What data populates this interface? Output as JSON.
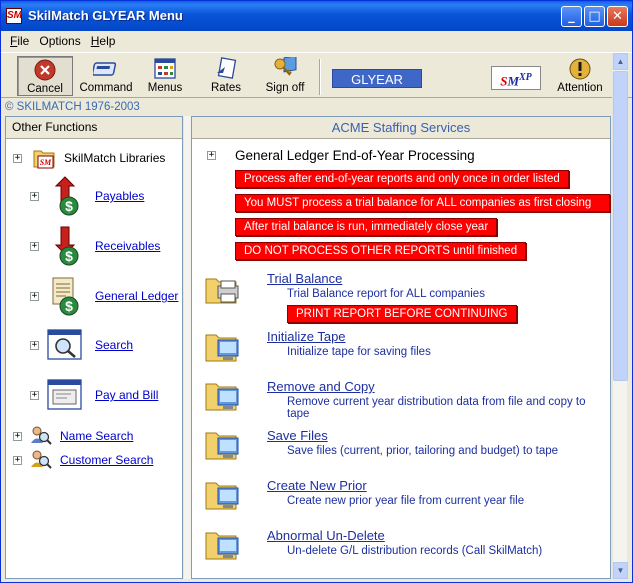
{
  "window": {
    "title": "SkilMatch GLYEAR Menu",
    "app_icon_text": "SM"
  },
  "menu": [
    {
      "label": "File",
      "key": "F",
      "rest": "ile"
    },
    {
      "label": "Options",
      "key": "",
      "rest": "Options"
    },
    {
      "label": "Help",
      "key": "H",
      "rest": "elp"
    }
  ],
  "toolbar": {
    "cancel": "Cancel",
    "command": "Command",
    "menus": "Menus",
    "rates": "Rates",
    "signoff": "Sign off",
    "module": "GLYEAR",
    "attention": "Attention"
  },
  "copyright": "© SKILMATCH 1976-2003",
  "left_panel": {
    "header": "Other Functions",
    "items": [
      {
        "label": "SkilMatch Libraries",
        "icon": "skilmatch-libraries-icon",
        "link": false
      },
      {
        "label": "Payables",
        "icon": "payables-icon",
        "link": true
      },
      {
        "label": "Receivables",
        "icon": "receivables-icon",
        "link": true
      },
      {
        "label": "General Ledger",
        "icon": "general-ledger-icon",
        "link": true
      },
      {
        "label": "Search",
        "icon": "search-icon",
        "link": true
      },
      {
        "label": "Pay and Bill",
        "icon": "pay-and-bill-icon",
        "link": true
      },
      {
        "label": "Name Search",
        "icon": "name-search-icon",
        "link": true
      },
      {
        "label": "Customer Search",
        "icon": "customer-search-icon",
        "link": true
      }
    ]
  },
  "right_panel": {
    "header": "ACME Staffing Services",
    "section_title": "General Ledger End-of-Year Processing",
    "warnings": [
      "Process after end-of-year reports and only once in order listed",
      "You MUST process a trial balance for ALL companies as first closing step",
      "After trial balance is run, immediately close year",
      "DO NOT PROCESS OTHER REPORTS until finished"
    ],
    "tasks": [
      {
        "title": "Trial Balance",
        "desc": "Trial Balance report for ALL companies",
        "note": "PRINT REPORT BEFORE CONTINUING"
      },
      {
        "title": "Initialize Tape",
        "desc": "Initialize tape for saving files"
      },
      {
        "title": "Remove and Copy",
        "desc": "Remove current year distribution data from file and copy to tape"
      },
      {
        "title": "Save Files",
        "desc": "Save files (current, prior, tailoring and budget) to tape"
      },
      {
        "title": "Create New Prior",
        "desc": "Create new prior year file from current year file"
      },
      {
        "title": "Abnormal Un-Delete",
        "desc": "Un-delete G/L distribution records (Call SkilMatch)"
      }
    ]
  },
  "colors": {
    "title_bar": "#0a55d8",
    "warning_red": "#ff0000",
    "link_blue": "#1d2fa0",
    "module_box": "#3e67c8"
  }
}
